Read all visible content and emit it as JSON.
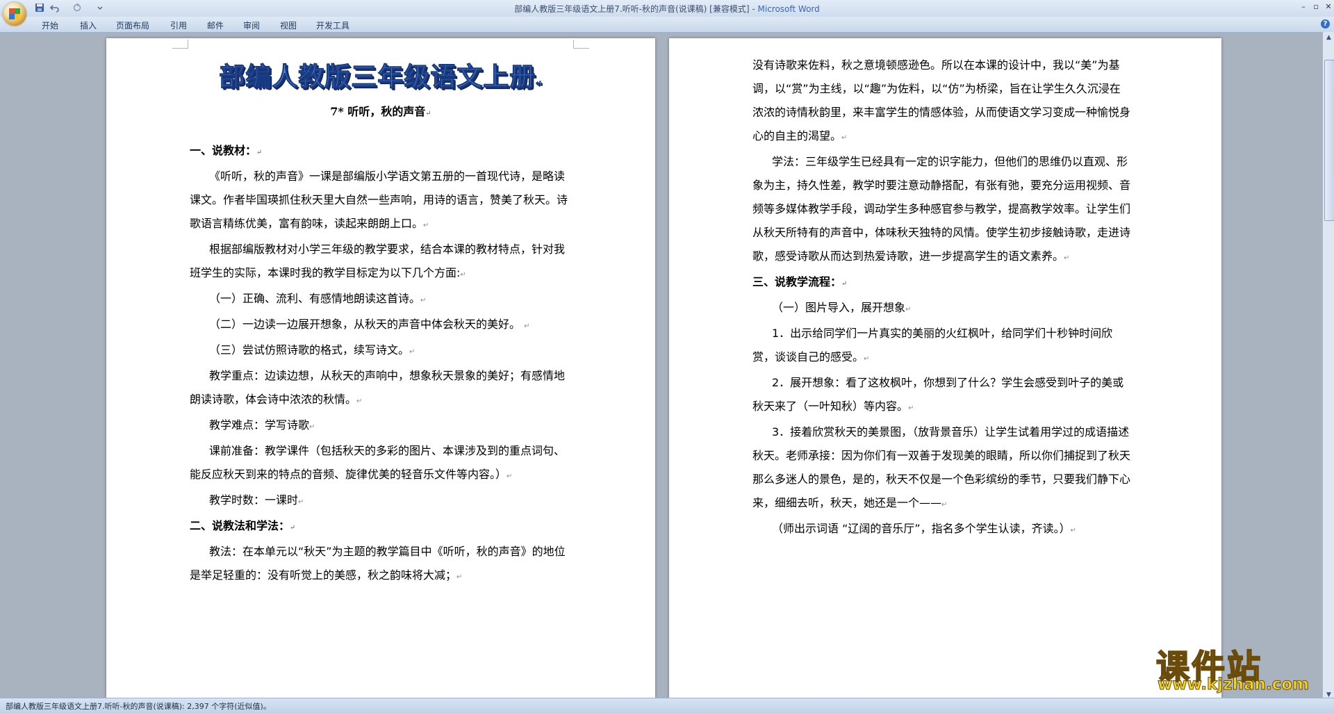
{
  "window": {
    "title_doc": "部编人教版三年级语文上册7.听听-秋的声音(说课稿) [兼容模式] - ",
    "title_app": "Microsoft Word"
  },
  "ribbon": {
    "tabs": [
      "开始",
      "插入",
      "页面布局",
      "引用",
      "邮件",
      "审阅",
      "视图",
      "开发工具"
    ]
  },
  "icons": {
    "office_button": "office-logo-icon",
    "save": "save-icon",
    "undo": "undo-icon",
    "redo": "redo-icon",
    "customize": "chevron-down-icon",
    "help": "help-icon"
  },
  "colors": {
    "title_fill": "#5a8ad6",
    "title_outline": "#173b83",
    "watermark": "#f5d820"
  },
  "document": {
    "title": "部编人教版三年级语文上册",
    "subtitle": "7* 听听，秋的声音",
    "left_page": [
      {
        "type": "h",
        "text": "一、说教材："
      },
      {
        "type": "p",
        "text": "《听听，秋的声音》一课是部编版小学语文第五册的一首现代诗，是略读课文。作者毕国瑛抓住秋天里大自然一些声响，用诗的语言，赞美了秋天。诗歌语言精练优美，富有韵味，读起来朗朗上口。"
      },
      {
        "type": "p",
        "text": "根据部编版教材对小学三年级的教学要求，结合本课的教材特点，针对我班学生的实际，本课时我的教学目标定为以下几个方面:"
      },
      {
        "type": "p",
        "text": "（一）正确、流利、有感情地朗读这首诗。"
      },
      {
        "type": "p",
        "text": "（二）一边读一边展开想象，从秋天的声音中体会秋天的美好。 "
      },
      {
        "type": "p",
        "text": "（三）尝试仿照诗歌的格式，续写诗文。"
      },
      {
        "type": "p",
        "text": "教学重点：边读边想，从秋天的声响中，想象秋天景象的美好；有感情地朗读诗歌，体会诗中浓浓的秋情。"
      },
      {
        "type": "p",
        "text": "教学难点：学写诗歌"
      },
      {
        "type": "p",
        "text": "课前准备：教学课件（包括秋天的多彩的图片、本课涉及到的重点词句、能反应秋天到来的特点的音频、旋律优美的轻音乐文件等内容。）"
      },
      {
        "type": "p",
        "text": "教学时数：一课时"
      },
      {
        "type": "h",
        "text": "二、说教法和学法："
      },
      {
        "type": "p",
        "text": "教法：在本单元以“秋天”为主题的教学篇目中《听听，秋的声音》的地位是举足轻重的：没有听觉上的美感，秋之韵味将大减；"
      }
    ],
    "right_page": [
      {
        "type": "c",
        "text": "没有诗歌来佐料，秋之意境顿感逊色。所以在本课的设计中，我以“美”为基调，以“赏”为主线，以“趣”为佐料，以“仿”为桥梁，旨在让学生久久沉浸在浓浓的诗情秋韵里，来丰富学生的情感体验，从而使语文学习变成一种愉悦身心的自主的渴望。"
      },
      {
        "type": "p",
        "text": "学法：三年级学生已经具有一定的识字能力，但他们的思维仍以直观、形象为主，持久性差，教学时要注意动静搭配，有张有弛，要充分运用视频、音频等多媒体教学手段，调动学生多种感官参与教学，提高教学效率。让学生们从秋天所特有的声音中，体味秋天独特的风情。使学生初步接触诗歌，走进诗歌，感受诗歌从而达到热爱诗歌，进一步提高学生的语文素养。"
      },
      {
        "type": "h",
        "text": "三、说教学流程："
      },
      {
        "type": "p",
        "text": "（一）图片导入，展开想象"
      },
      {
        "type": "p",
        "text": "1．出示给同学们一片真实的美丽的火红枫叶，给同学们十秒钟时间欣赏，谈谈自己的感受。"
      },
      {
        "type": "p",
        "text": "2．展开想象：看了这枚枫叶，你想到了什么？学生会感受到叶子的美或秋天来了（一叶知秋）等内容。"
      },
      {
        "type": "p",
        "text": "3．接着欣赏秋天的美景图，（放背景音乐）让学生试着用学过的成语描述秋天。老师承接：因为你们有一双善于发现美的眼睛，所以你们捕捉到了秋天那么多迷人的景色，是的，秋天不仅是一个色彩缤纷的季节，只要我们静下心来，细细去听，秋天，她还是一个——"
      },
      {
        "type": "p",
        "text": "（师出示词语 “辽阔的音乐厅”，指名多个学生认读，齐读。）"
      }
    ]
  },
  "status": {
    "text": "部编人教版三年级语文上册7.听听-秋的声音(说课稿): 2,397 个字符(近似值)。"
  },
  "watermark": {
    "cn": "课件站",
    "url": "www.kjzhan.com"
  }
}
